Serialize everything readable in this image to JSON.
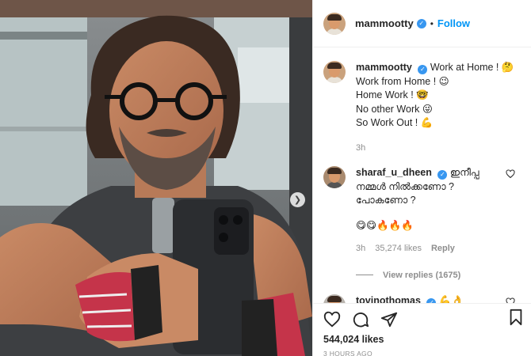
{
  "post": {
    "username": "mammootty",
    "separator": "•",
    "follow_label": "Follow",
    "caption": {
      "username": "mammootty",
      "lines": [
        "Work at Home ! 🤔",
        "Work from Home ! 😉",
        "Home Work ! 🤓",
        "No other Work 😜",
        "So Work Out ! 💪"
      ],
      "time": "3h"
    },
    "likes": "544,024 likes",
    "posted": "3 HOURS AGO"
  },
  "comments": [
    {
      "username": "sharaf_u_dheen",
      "lines": [
        "ഇനീപ്പ",
        "നമ്മൾ നിൽക്കണോ ?",
        "പോകണോ ?"
      ],
      "emoji_line": "😋😋🔥🔥🔥",
      "time": "3h",
      "likes": "35,274 likes",
      "reply_label": "Reply",
      "view_replies": "View replies (1675)"
    },
    {
      "username": "tovinothomas",
      "text": "💪👌"
    }
  ],
  "colors": {
    "accent": "#0095f6",
    "verified": "#3897f0",
    "muted": "#8e8e8e",
    "text": "#262626"
  },
  "icons": [
    "heart-icon",
    "comment-icon",
    "share-icon",
    "bookmark-icon",
    "verified-icon",
    "chevron-right-icon"
  ]
}
